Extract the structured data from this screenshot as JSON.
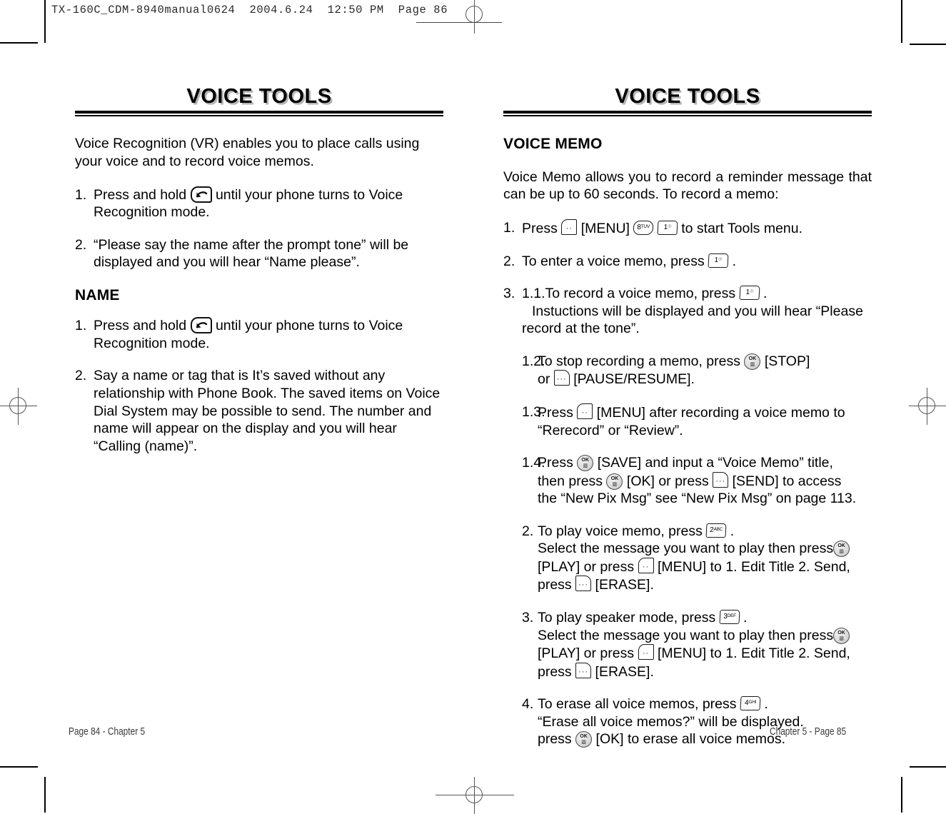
{
  "running_head": {
    "file": "TX-160C_CDM-8940manual0624",
    "date": "2004.6.24",
    "time": "12:50 PM",
    "page": "Page 86"
  },
  "left_page": {
    "banner_title": "VOICE TOOLS",
    "intro": "Voice Recognition (VR) enables you to place calls using your voice and to record voice memos.",
    "step1_num": "1.",
    "step1_a": "Press and hold",
    "step1_b": "until your phone turns to Voice Recognition mode.",
    "step2_num": "2.",
    "step2_text": "“Please say the name after the prompt tone” will be displayed and you will hear “Name please”.",
    "subhead": "NAME",
    "name_step1_num": "1.",
    "name_step1_a": "Press and hold",
    "name_step1_b": "until your phone turns to Voice Recognition mode.",
    "name_step2_num": "2.",
    "name_step2_text": "Say a name or tag that is It’s saved without any relationship with Phone Book. The saved items on Voice Dial System may be possible to send. The number and name will appear on the display and you will hear “Calling (name)”.",
    "footer": "Page 84 - Chapter 5"
  },
  "right_page": {
    "banner_title": "VOICE TOOLS",
    "subhead": "VOICE MEMO",
    "intro": "Voice Memo allows you to record a reminder message that can be up to 60 seconds. To record a memo:",
    "step1_num": "1.",
    "step1_a": "Press",
    "step1_menu": "[MENU]",
    "step1_b": "to start Tools menu.",
    "step2_num": "2.",
    "step2_a": "To enter a voice memo, press",
    "step2_b": ".",
    "step3_num": "3.",
    "step3_sub": "1.1.",
    "step3_a": "To record a voice memo, press",
    "step3_b": ".",
    "step3_c": "Instuctions will be displayed and you will hear “Please record at the tone”.",
    "sub12_num": "1.2.",
    "sub12_a": "To stop recording a memo, press",
    "sub12_stop": "[STOP]",
    "sub12_or": "or",
    "sub12_pause": "[PAUSE/RESUME].",
    "sub13_num": "1.3.",
    "sub13_a": "Press",
    "sub13_menu": "[MENU]",
    "sub13_b": "after recording a voice memo to “Rerecord” or “Review”.",
    "sub14_num": "1.4.",
    "sub14_a": "Press",
    "sub14_save": "[SAVE] and input a “Voice Memo” title,",
    "sub14_then": "then press",
    "sub14_ok": "[OK] or press",
    "sub14_send": "[SEND] to access",
    "sub14_tail": "the “New Pix Msg” see “New Pix Msg” on page 113.",
    "play2_num": "2.",
    "play2_a": "To play voice memo, press",
    "play2_b": ".",
    "play2_c": "Select the message you want to play then press",
    "play2_play": "[PLAY] or press",
    "play2_menu": "[MENU] to 1. Edit Title 2. Send,",
    "play2_press": "press",
    "play2_erase": "[ERASE].",
    "play3_num": "3.",
    "play3_a": "To play speaker mode, press",
    "play3_b": ".",
    "play3_c": "Select the message you want to play then press",
    "play3_play": "[PLAY] or press",
    "play3_menu": "[MENU] to 1. Edit Title 2. Send,",
    "play3_press": "press",
    "play3_erase": "[ERASE].",
    "erase4_num": "4.",
    "erase4_a": "To erase all voice memos, press",
    "erase4_b": ".",
    "erase4_c": "“Erase all voice memos?” will be displayed.",
    "erase4_press": "press",
    "erase4_ok": "[OK] to erase all voice memos.",
    "footer": "Chapter 5 - Page 85"
  },
  "keys": {
    "send_key": "send-call-key",
    "soft_left": "soft-key-menu",
    "soft_right": "soft-key-send",
    "ok_key_top": "OK",
    "key_1_digit": "1",
    "key_1_alpha": "☉",
    "key_2_digit": "2",
    "key_2_alpha": "ABC",
    "key_3_digit": "3",
    "key_3_alpha": "DEF",
    "key_4_digit": "4",
    "key_4_alpha": "GHI",
    "key_8_digit": "8",
    "key_8_alpha": "TUV"
  }
}
